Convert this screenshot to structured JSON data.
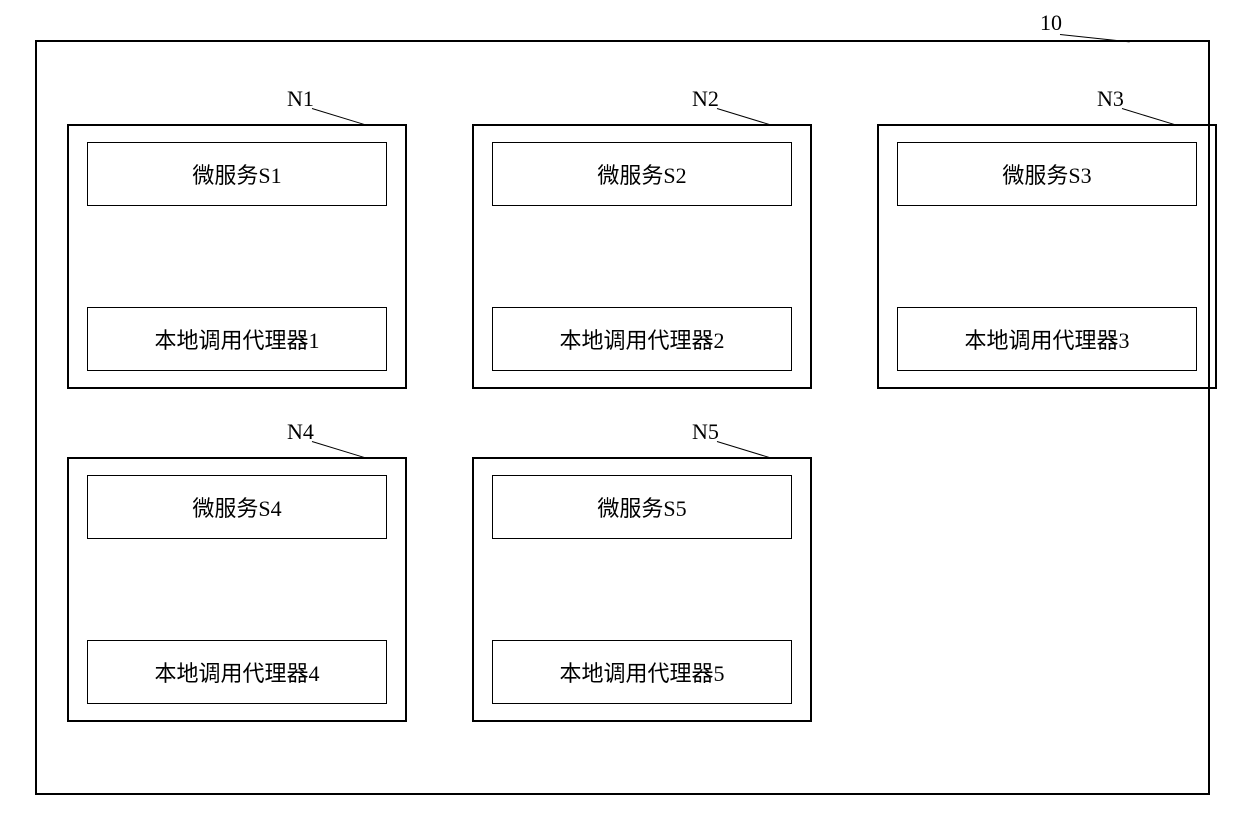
{
  "container": {
    "label": "10"
  },
  "nodes": [
    {
      "id": "N1",
      "service": "微服务S1",
      "agent": "本地调用代理器1"
    },
    {
      "id": "N2",
      "service": "微服务S2",
      "agent": "本地调用代理器2"
    },
    {
      "id": "N3",
      "service": "微服务S3",
      "agent": "本地调用代理器3"
    },
    {
      "id": "N4",
      "service": "微服务S4",
      "agent": "本地调用代理器4"
    },
    {
      "id": "N5",
      "service": "微服务S5",
      "agent": "本地调用代理器5"
    }
  ]
}
